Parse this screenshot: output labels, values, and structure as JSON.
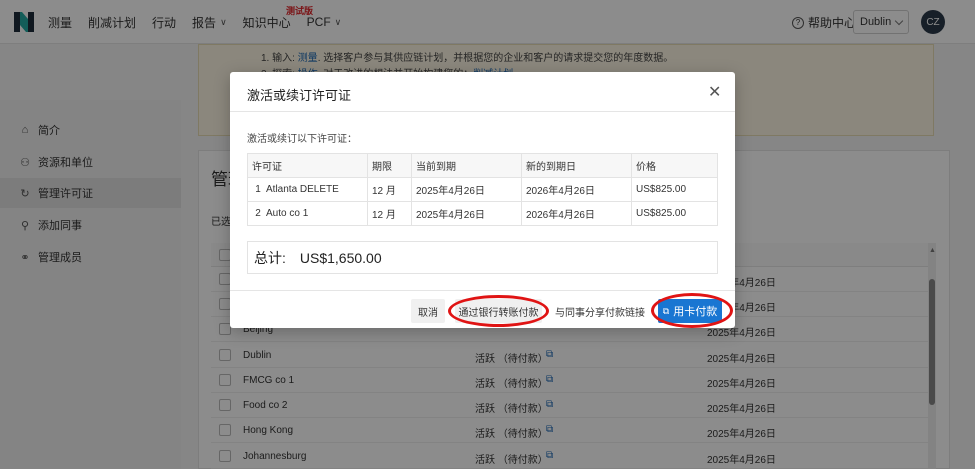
{
  "nav": {
    "items": [
      {
        "label": "测量"
      },
      {
        "label": "削减计划"
      },
      {
        "label": "行动"
      },
      {
        "label": "报告",
        "dropdown": true
      },
      {
        "label": "知识中心"
      },
      {
        "label": "PCF",
        "dropdown": true
      }
    ],
    "beta_tag": "测试版",
    "help": "帮助中心",
    "city": "Dublin",
    "avatar": "CZ"
  },
  "banner": {
    "line1_prefix": "1. 输入: ",
    "line1_link": "测量",
    "line1_suffix": ". 选择客户参与其供应链计划，并根据您的企业和客户的请求提交您的年度数据。",
    "line2_prefix": "2. 探索: ",
    "line2_link": "操作",
    "line2_mid": ". 对于改进的想法并开始构建您的：",
    "line2_link2": "削减计划"
  },
  "sidebar": {
    "items": [
      {
        "label": "简介",
        "icon": "home-icon",
        "glyph": "⌂"
      },
      {
        "label": "资源和单位",
        "icon": "org-icon",
        "glyph": "⚇"
      },
      {
        "label": "管理许可证",
        "icon": "refresh-icon",
        "glyph": "↻",
        "active": true
      },
      {
        "label": "添加同事",
        "icon": "user-icon",
        "glyph": "⚲"
      },
      {
        "label": "管理成员",
        "icon": "users-icon",
        "glyph": "⚭"
      }
    ]
  },
  "main": {
    "title": "管理",
    "selected": "已选",
    "rows": [
      {
        "name": "",
        "status": "",
        "date": "2025年4月26日"
      },
      {
        "name": "",
        "status": "",
        "date": "2025年4月26日"
      },
      {
        "name": "Beijing",
        "status": "",
        "date": "2025年4月26日"
      },
      {
        "name": "Dublin",
        "status": "活跃 （待付款）",
        "date": "2025年4月26日"
      },
      {
        "name": "FMCG co 1",
        "status": "活跃 （待付款）",
        "date": "2025年4月26日"
      },
      {
        "name": "Food co 2",
        "status": "活跃 （待付款）",
        "date": "2025年4月26日"
      },
      {
        "name": "Hong Kong",
        "status": "活跃 （待付款）",
        "date": "2025年4月26日"
      },
      {
        "name": "Johannesburg",
        "status": "活跃 （待付款）",
        "date": "2025年4月26日"
      }
    ]
  },
  "modal": {
    "title": "激活或续订许可证",
    "description": "激活或续订以下许可证：",
    "columns": [
      "许可证",
      "期限",
      "当前到期",
      "新的到期日",
      "价格"
    ],
    "rows": [
      {
        "idx": "1",
        "license": "Atlanta DELETE",
        "term": "12 月",
        "current": "2025年4月26日",
        "new": "2026年4月26日",
        "price": "US$825.00"
      },
      {
        "idx": "2",
        "license": "Auto co 1",
        "term": "12 月",
        "current": "2025年4月26日",
        "new": "2026年4月26日",
        "price": "US$825.00"
      }
    ],
    "total_label": "总计:",
    "total_value": "US$1,650.00",
    "buttons": {
      "cancel": "取消",
      "bank": "通过银行转账付款",
      "share": "与同事分享付款链接",
      "card": "用卡付款"
    }
  },
  "colors": {
    "primary": "#1976d2",
    "highlight": "#e01414",
    "beta": "#e0262b"
  }
}
